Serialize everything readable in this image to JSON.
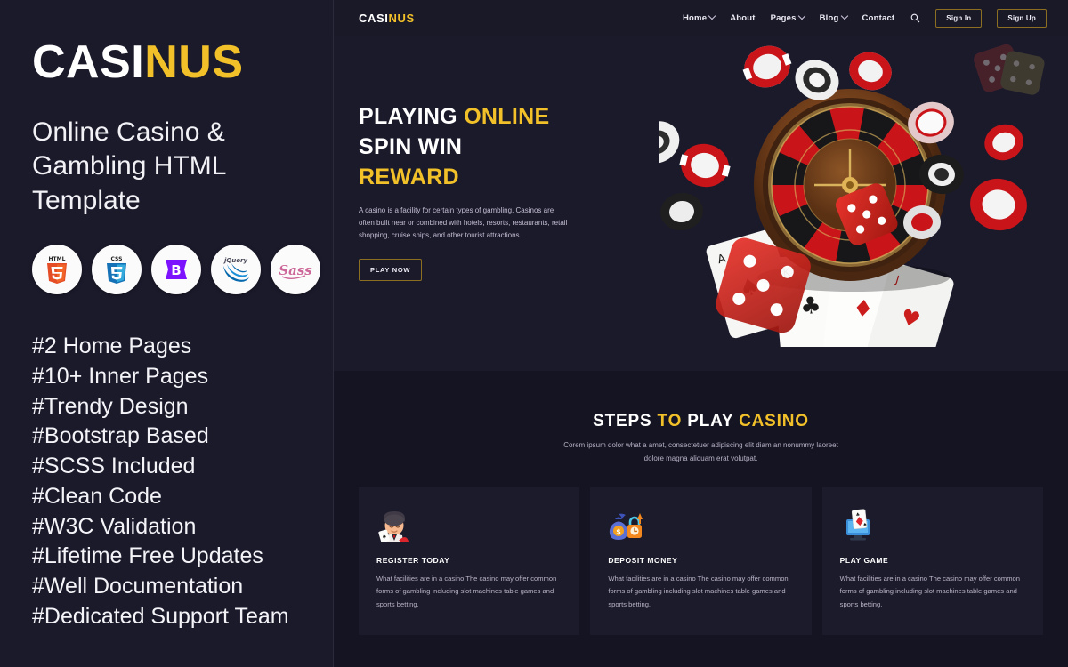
{
  "promo": {
    "logo": {
      "white": "CASI",
      "gold": "NUS"
    },
    "subtitle": "Online Casino & Gambling HTML Template",
    "tech_badges": [
      {
        "name": "html5-badge",
        "label": "HTML5"
      },
      {
        "name": "css3-badge",
        "label": "CSS3"
      },
      {
        "name": "bootstrap-badge",
        "label": "Bootstrap"
      },
      {
        "name": "jquery-badge",
        "label": "jQuery"
      },
      {
        "name": "sass-badge",
        "label": "Sass"
      }
    ],
    "features": [
      "#2 Home Pages",
      "#10+ Inner Pages",
      "#Trendy Design",
      "#Bootstrap Based",
      "#SCSS Included",
      "#Clean Code",
      "#W3C Validation",
      "#Lifetime Free Updates",
      "#Well Documentation",
      "#Dedicated Support Team"
    ]
  },
  "site": {
    "navbar": {
      "logo": {
        "white": "CASI",
        "gold": "NUS"
      },
      "links": [
        {
          "label": "Home",
          "has_dropdown": true
        },
        {
          "label": "About",
          "has_dropdown": false
        },
        {
          "label": "Pages",
          "has_dropdown": true
        },
        {
          "label": "Blog",
          "has_dropdown": true
        },
        {
          "label": "Contact",
          "has_dropdown": false
        }
      ],
      "search_icon": "search-icon",
      "sign_in_label": "Sign In",
      "sign_up_label": "Sign Up"
    },
    "hero": {
      "title_line1_white": "PLAYING",
      "title_line1_gold": "ONLINE",
      "title_line2": "SPIN WIN",
      "title_line3_gold": "REWARD",
      "paragraph": "A casino is a facility for certain types of gambling. Casinos are often built near or combined with hotels, resorts, restaurants, retail shopping, cruise ships, and other tourist attractions.",
      "cta_label": "PLAY NOW",
      "artwork": "roulette-wheel-chips-dice-cards"
    },
    "steps": {
      "heading_part1": "STEPS ",
      "heading_gold1": "TO",
      "heading_part2": " PLAY ",
      "heading_gold2": "CASINO",
      "subtitle": "Corem ipsum dolor what a amet, consectetuer adipiscing elit diam an nonummy laoreet dolore magna aliquam erat volutpat.",
      "cards": [
        {
          "icon": "croupier-dealer-icon",
          "title": "REGISTER TODAY",
          "text": "What facilities are in a casino The casino may offer common forms of gambling including slot machines table games and sports betting."
        },
        {
          "icon": "money-bag-lock-icon",
          "title": "DEPOSIT MONEY",
          "text": "What facilities are in a casino The casino may offer common forms of gambling including slot machines table games and sports betting."
        },
        {
          "icon": "monitor-cards-icon",
          "title": "PLAY GAME",
          "text": "What facilities are in a casino The casino may offer common forms of gambling including slot machines table games and sports betting."
        }
      ]
    }
  },
  "colors": {
    "gold": "#f2c029",
    "panel_bg": "#1b1a2b",
    "section_bg": "#161523",
    "card_bg": "#1c1b2b",
    "text_light": "#ffffff",
    "text_muted": "#b9b4c8",
    "border_gold": "#8c6f21"
  }
}
